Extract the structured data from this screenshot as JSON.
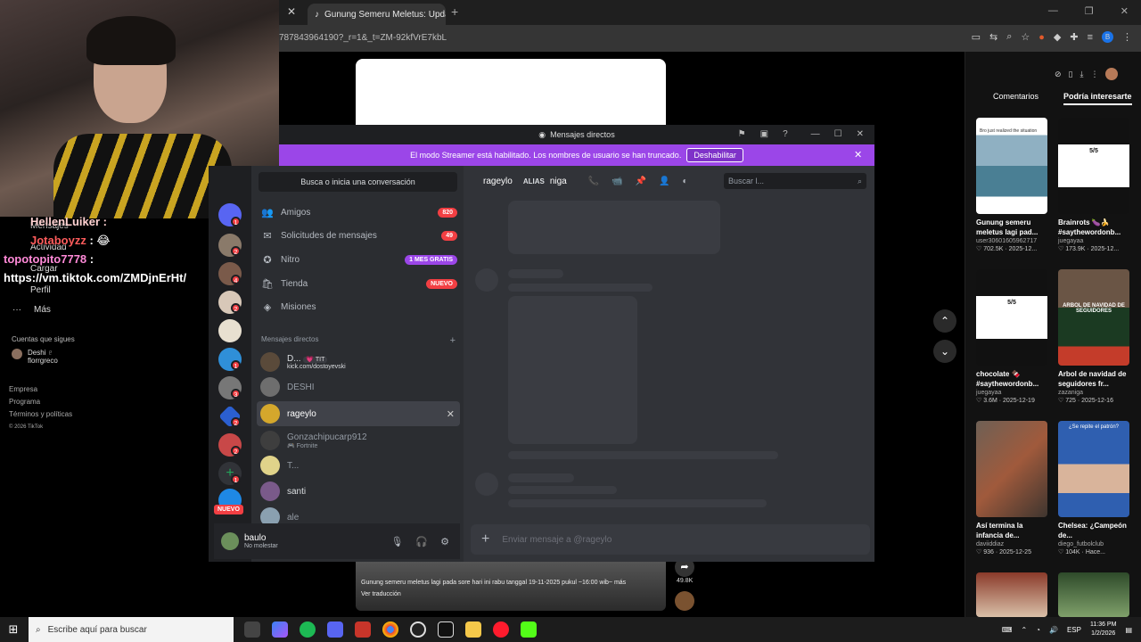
{
  "browser": {
    "tab_title": "Gunung Semeru Meletus: Upda",
    "url": "787843964190?_r=1&_t=ZM-92kfVrE7kbL"
  },
  "stream_chat": [
    {
      "user": "HellenLuiker",
      "msg": ":",
      "color": "#ffffff"
    },
    {
      "user": "Jotaboyzz",
      "msg": ": 😂",
      "color": "#ff5c5c"
    },
    {
      "user": "topotopito7778",
      "msg": ":",
      "color": "#ff8ad8"
    },
    {
      "user": "",
      "msg": "https://vm.tiktok.com/ZMDjnErHt/",
      "color": "#ffffff"
    }
  ],
  "tiktok_left": {
    "nav": [
      "Mensajes",
      "Actividad",
      "Cargar",
      "Perfil"
    ],
    "more": "Más",
    "following_title": "Cuentas que sigues",
    "following_user": "Deshi ♇",
    "following_handle": "florrgreco",
    "footer": [
      "Empresa",
      "Programa",
      "Términos y políticas"
    ],
    "copyright": "© 2026 TikTok"
  },
  "tiktok_video": {
    "caption": "Gunung semeru meletus lagi pada sore hari ini rabu tanggal 19-11-2025 pukul ~16:00 wib~ más",
    "translate": "Ver traducción",
    "shares": "49.8K",
    "up_icon": "chevron-up",
    "down_icon": "chevron-down"
  },
  "tiktok_right": {
    "tabs": [
      "Comentarios",
      "Podría interesarte"
    ],
    "cards": [
      {
        "title": "Gunung semeru meletus lagi pad...",
        "user": "user30601605962717",
        "likes": "702.5K",
        "date": "2025-12..."
      },
      {
        "title": "Brainrots 🍆🍌 #saythewordonb...",
        "user": "juegayaa",
        "likes": "173.9K",
        "date": "2025-12..."
      },
      {
        "title": "chocolate 🍫 #saythewordonb...",
        "user": "juegayaa",
        "likes": "3.6M",
        "date": "2025-12-19"
      },
      {
        "title": "Arbol de navidad de seguidores fr...",
        "user": "zazaniga",
        "likes": "725",
        "date": "2025-12-16"
      },
      {
        "title": "Así termina la infancia de...",
        "user": "daviiddiaz",
        "likes": "936",
        "date": "2025-12-25"
      },
      {
        "title": "Chelsea: ¿Campeón de...",
        "user": "diego_futbolclub",
        "likes": "104K",
        "date": "Hace..."
      }
    ],
    "thumb_texts": [
      "Bro just realized the situation",
      "5/5",
      "ARBOL DE NAVIDAD DE SEGUIDORES",
      "5/5",
      "¿Se repite el patrón?"
    ]
  },
  "discord": {
    "window_title": "Mensajes directos",
    "banner_text": "El modo Streamer está habilitado. Los nombres de usuario se han truncado.",
    "banner_button": "Deshabilitar",
    "search_placeholder": "Busca o inicia una conversación",
    "nav": [
      {
        "label": "Amigos",
        "badge": "820"
      },
      {
        "label": "Solicitudes de mensajes",
        "badge": "49"
      },
      {
        "label": "Nitro",
        "badge": "1 MES GRATIS"
      },
      {
        "label": "Tienda",
        "badge": "NUEVO"
      },
      {
        "label": "Misiones",
        "badge": ""
      }
    ],
    "dm_header": "Mensajes directos",
    "dms": [
      {
        "name": "D...",
        "tag": "💗 TIT",
        "sub": "kick.com/dostoyevski"
      },
      {
        "name": "DESHI",
        "sub": ""
      },
      {
        "name": "rageylo",
        "sub": ""
      },
      {
        "name": "Gonzachipucarp912",
        "sub": "🎮 Fortnite"
      },
      {
        "name": "T...",
        "sub": ""
      },
      {
        "name": "santi",
        "sub": ""
      },
      {
        "name": "ale",
        "sub": ""
      }
    ],
    "server_badges": [
      "1",
      "2",
      "4",
      "2",
      "1",
      "3",
      "2",
      "2",
      "1"
    ],
    "server_new": "NUEVO",
    "user": {
      "name": "baulo",
      "status": "No molestar"
    },
    "chat": {
      "name": "rageylo",
      "alias_label": "ALIAS",
      "alias": "niga",
      "search_placeholder": "Buscar l...",
      "input_placeholder": "Enviar mensaje a @rageylo"
    }
  },
  "taskbar": {
    "search_placeholder": "Escribe aquí para buscar",
    "lang": "ESP",
    "time": "11:36 PM",
    "date": "1/2/2026"
  }
}
